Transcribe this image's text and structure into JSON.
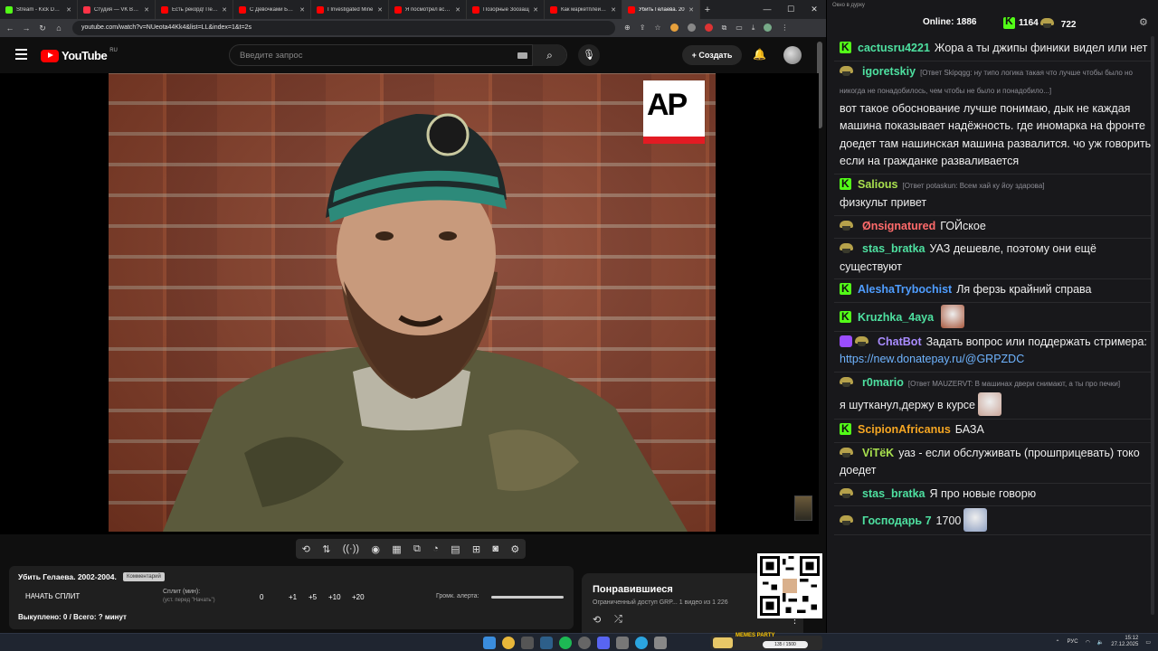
{
  "browser": {
    "tabs": [
      {
        "label": "Stream - Kick Dashb",
        "icon": "kick"
      },
      {
        "label": "Студия — VK Видео",
        "icon": "vk"
      },
      {
        "label": "Есть рекорд! Пере",
        "icon": "yt"
      },
      {
        "label": "С Девочками Болт",
        "icon": "yt"
      },
      {
        "label": "I Investigated Mine",
        "icon": "yt"
      },
      {
        "label": "Я посмотрел все С",
        "icon": "yt"
      },
      {
        "label": "Позорные Зоозащ",
        "icon": "yt"
      },
      {
        "label": "Как маркетплейсы",
        "icon": "yt"
      },
      {
        "label": "Убить Гелаева. 20",
        "icon": "yt",
        "active": true
      }
    ],
    "url": "youtube.com/watch?v=NUeota44Kk4&list=LL&index=1&t=2s"
  },
  "youtube": {
    "logo_text": "YouTube",
    "region": "RU",
    "search_placeholder": "Введите запрос",
    "create_label": "+ Создать"
  },
  "video": {
    "watermark": "AP"
  },
  "split_panel": {
    "title": "Убить Гелаева. 2002-2004.",
    "tag": "Комментарий",
    "start_label": "НАЧАТЬ СПЛИТ",
    "split_label": "Сплит (мин):",
    "split_sub": "(уст. перед \"Начать\")",
    "values": [
      "0",
      "+1",
      "+5",
      "+10",
      "+20"
    ],
    "alert_label": "Громк. алерта:",
    "alert_level": 1.0,
    "bought": "Выкуплено: 0 / Всего: ? минут"
  },
  "liked": {
    "title": "Понравившиеся",
    "desc": "Ограниченный доступ GRP... 1 видео из 1 226"
  },
  "chat": {
    "window_title": "Окно в дурку",
    "online_label": "Online:",
    "online_count": "1886",
    "kick_count": "1164",
    "gold_count": "722",
    "messages": [
      {
        "badge": "k",
        "nick": "cactusru4221",
        "color": "#4ee0a0",
        "reply": "",
        "text": "Жора а ты джипы финики видел или нет"
      },
      {
        "badge": "g",
        "nick": "igoretskiy",
        "color": "#4ee0a0",
        "reply": "[Ответ Skipqgg: ну типо логика такая что лучше чтобы было но никогда не понадобилось, чем чтобы не было и понадобило...]",
        "text": "вот такое обоснование лучше понимаю, дык не каждая машина показывает надёжность. где иномарка на фронте доедет там нашинская машина развалится. чо уж говорить если на гражданке разваливается"
      },
      {
        "badge": "k",
        "nick": "Salious",
        "color": "#a8e04e",
        "reply": "[Ответ potaskun: Всем хай ку йоу здарова]",
        "text": "физкульт привет"
      },
      {
        "badge": "g",
        "nick": "Ønsignatured",
        "color": "#ff6b6b",
        "reply": "",
        "text": "ГОЙское"
      },
      {
        "badge": "g",
        "nick": "stas_bratka",
        "color": "#4ee0a0",
        "reply": "",
        "text": "УАЗ дешевле, поэтому они ещё существуют"
      },
      {
        "badge": "k",
        "nick": "AleshaTrybochist",
        "color": "#4f9dff",
        "reply": "",
        "text": "Ля ферзь крайний справа"
      },
      {
        "badge": "k",
        "nick": "Kruzhka_4aya",
        "color": "#4ee0a0",
        "reply": "",
        "text": "",
        "emote": "#a8573c"
      },
      {
        "badge": "bot",
        "nick": "ChatBot",
        "color": "#a98cff",
        "reply": "",
        "text": "Задать вопрос или поддержать стримера:",
        "link": "https://new.donatepay.ru/@GRPZDC"
      },
      {
        "badge": "g",
        "nick": "r0mario",
        "color": "#4ee0a0",
        "reply": "[Ответ MAUZERVT: В машинах двери снимают, а ты про печки]",
        "text": "я шутканул,держу в курсе",
        "emote": "#c9a497"
      },
      {
        "badge": "k",
        "nick": "ScipionAfricanus",
        "color": "#f5a623",
        "reply": "",
        "text": "БАЗА"
      },
      {
        "badge": "g",
        "nick": "ViTëK",
        "color": "#a8e04e",
        "reply": "",
        "text": "уаз - если обслуживать (прошприцевать) токо доедет"
      },
      {
        "badge": "g",
        "nick": "stas_bratka",
        "color": "#4ee0a0",
        "reply": "",
        "text": "Я про новые говорю"
      },
      {
        "badge": "g",
        "nick": "Господарь 7",
        "color": "#4ee0a0",
        "reply": "",
        "text": "1700",
        "emote": "#8d9fc2"
      }
    ]
  },
  "taskbar": {
    "memes_title": "MEMES PARTY",
    "memes_progress": "135 / 1500",
    "lang": "РУС",
    "time": "15:12",
    "date": "27.12.2025"
  }
}
